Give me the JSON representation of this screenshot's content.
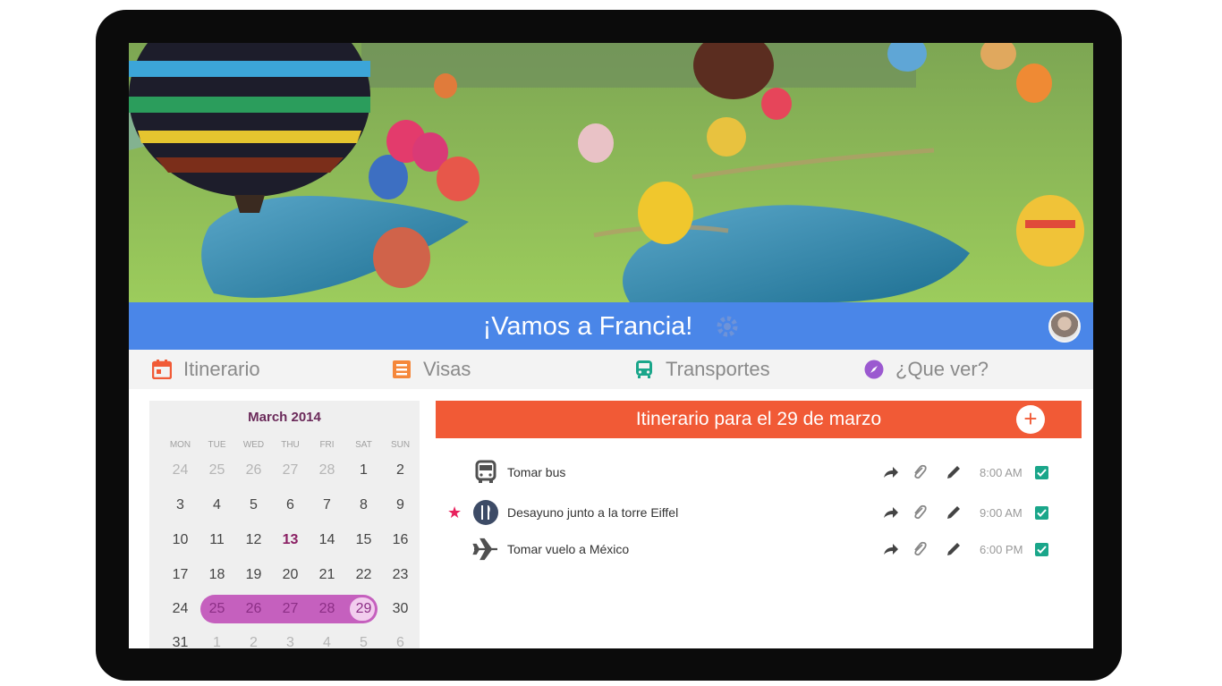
{
  "header": {
    "title": "¡Vamos a Francia!",
    "settings_icon": "gear-icon",
    "avatar_icon": "user-avatar"
  },
  "tabs": [
    {
      "label": "Itinerario",
      "icon": "calendar-icon",
      "color": "#f15a36"
    },
    {
      "label": "Visas",
      "icon": "list-icon",
      "color": "#f5873a"
    },
    {
      "label": "Transportes",
      "icon": "bus-icon",
      "color": "#1aa68a"
    },
    {
      "label": "¿Que ver?",
      "icon": "compass-icon",
      "color": "#9b59d0"
    }
  ],
  "calendar": {
    "title": "March 2014",
    "weekdays": [
      "MON",
      "TUE",
      "WED",
      "THU",
      "FRI",
      "SAT",
      "SUN"
    ],
    "weeks": [
      [
        "24",
        "25",
        "26",
        "27",
        "28",
        "1",
        "2"
      ],
      [
        "3",
        "4",
        "5",
        "6",
        "7",
        "8",
        "9"
      ],
      [
        "10",
        "11",
        "12",
        "13",
        "14",
        "15",
        "16"
      ],
      [
        "17",
        "18",
        "19",
        "20",
        "21",
        "22",
        "23"
      ],
      [
        "24",
        "25",
        "26",
        "27",
        "28",
        "29",
        "30"
      ],
      [
        "31",
        "1",
        "2",
        "3",
        "4",
        "5",
        "6"
      ]
    ],
    "today": "13",
    "range": [
      "25",
      "26",
      "27",
      "28",
      "29"
    ],
    "selected": "29",
    "range_color": "#c560be"
  },
  "itinerary": {
    "title": "Itinerario para el 29 de marzo",
    "add_label": "+",
    "items": [
      {
        "label": "Tomar bus",
        "icon": "bus-icon",
        "time": "8:00 AM",
        "starred": false
      },
      {
        "label": "Desayuno junto a la torre Eiffel",
        "icon": "restaurant-icon",
        "time": "9:00 AM",
        "starred": true
      },
      {
        "label": "Tomar vuelo a México",
        "icon": "airplane-icon",
        "time": "6:00 PM",
        "starred": false
      }
    ],
    "star_glyph": "★"
  },
  "colors": {
    "header_blue": "#4a86e8",
    "accent_orange": "#f15a36",
    "check_green": "#1aa68a"
  }
}
